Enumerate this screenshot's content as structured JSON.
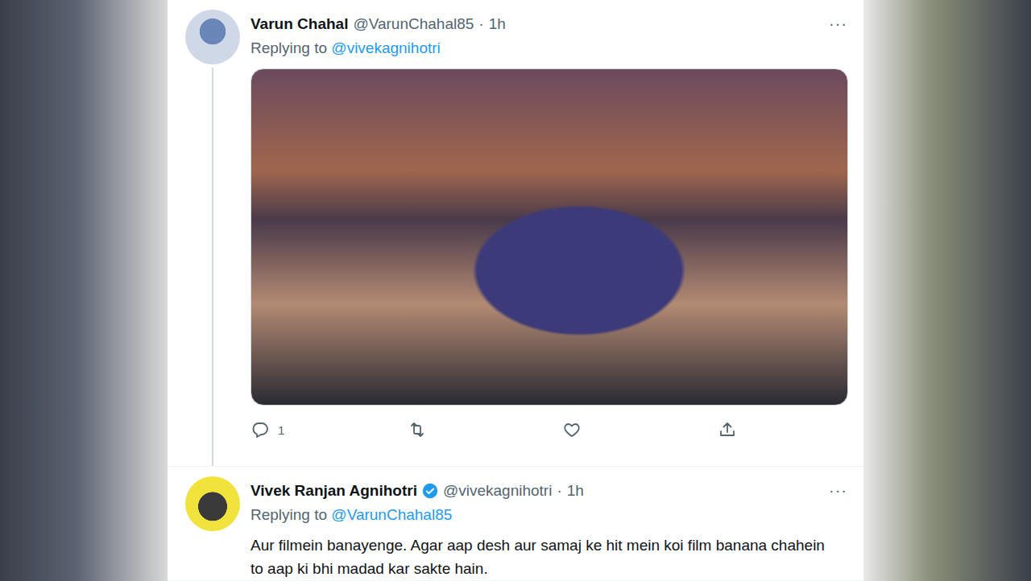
{
  "tweets": [
    {
      "name": "Varun Chahal",
      "verified": false,
      "handle": "@VarunChahal85",
      "sep": "·",
      "time": "1h",
      "menu": "···",
      "replying_label": "Replying to",
      "replying_to": "@vivekagnihotri",
      "has_media": true,
      "body": "",
      "actions": [
        {
          "kind": "reply",
          "count": "1"
        },
        {
          "kind": "retweet",
          "count": ""
        },
        {
          "kind": "like",
          "count": ""
        },
        {
          "kind": "share",
          "count": ""
        }
      ]
    },
    {
      "name": "Vivek Ranjan Agnihotri",
      "verified": true,
      "handle": "@vivekagnihotri",
      "sep": "·",
      "time": "1h",
      "menu": "···",
      "replying_label": "Replying to",
      "replying_to": "@VarunChahal85",
      "has_media": false,
      "body": "Aur filmein banayenge. Agar aap desh aur samaj ke hit mein koi film banana chahein to aap ki bhi madad kar sakte hain.",
      "actions": []
    }
  ]
}
